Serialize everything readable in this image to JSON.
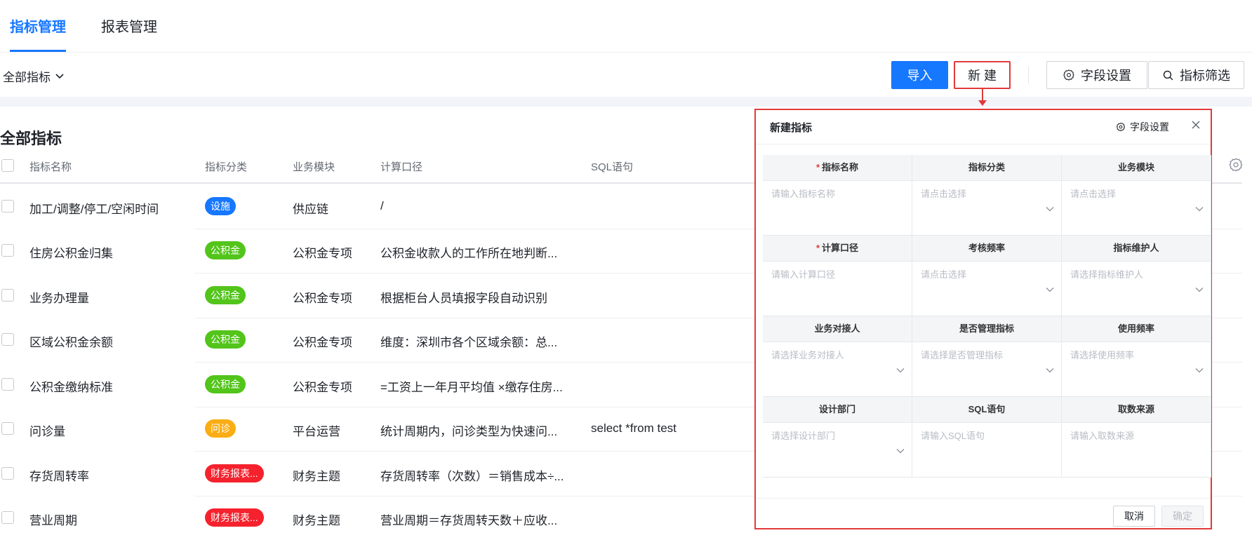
{
  "tabs": [
    {
      "label": "指标管理",
      "active": true
    },
    {
      "label": "报表管理",
      "active": false
    }
  ],
  "toolbar": {
    "filter": "全部指标",
    "import": "导入",
    "new": "新 建",
    "field_settings": "字段设置",
    "filter_btn": "指标筛选"
  },
  "table": {
    "title": "全部指标",
    "headers": [
      "指标名称",
      "指标分类",
      "业务模块",
      "计算口径",
      "SQL语句"
    ],
    "rows": [
      {
        "name": "加工/调整/停工/空闲时间",
        "tag": "设施",
        "tag_color": "#1677ff",
        "module": "供应链",
        "calc": "/",
        "sql": ""
      },
      {
        "name": "住房公积金归集",
        "tag": "公积金",
        "tag_color": "#52c41a",
        "module": "公积金专项",
        "calc": "公积金收款人的工作所在地判断...",
        "sql": ""
      },
      {
        "name": "业务办理量",
        "tag": "公积金",
        "tag_color": "#52c41a",
        "module": "公积金专项",
        "calc": "根据柜台人员填报字段自动识别",
        "sql": ""
      },
      {
        "name": "区域公积金余额",
        "tag": "公积金",
        "tag_color": "#52c41a",
        "module": "公积金专项",
        "calc": "维度：深圳市各个区域余额：总...",
        "sql": ""
      },
      {
        "name": "公积金缴纳标准",
        "tag": "公积金",
        "tag_color": "#52c41a",
        "module": "公积金专项",
        "calc": "=工资上一年月平均值 ×缴存住房...",
        "sql": ""
      },
      {
        "name": "问诊量",
        "tag": "问诊",
        "tag_color": "#faad14",
        "module": "平台运营",
        "calc": "统计周期内，问诊类型为快速问...",
        "sql": "select *from test"
      },
      {
        "name": "存货周转率",
        "tag": "财务报表...",
        "tag_color": "#f5222d",
        "module": "财务主题",
        "calc": "存货周转率（次数）＝销售成本÷...",
        "sql": ""
      },
      {
        "name": "营业周期",
        "tag": "财务报表...",
        "tag_color": "#f5222d",
        "module": "财务主题",
        "calc": "营业周期＝存货周转天数＋应收...",
        "sql": ""
      }
    ]
  },
  "panel": {
    "title": "新建指标",
    "field_settings": "字段设置",
    "fields": [
      {
        "label": "指标名称",
        "required": true,
        "placeholder": "请输入指标名称",
        "select": false
      },
      {
        "label": "指标分类",
        "required": false,
        "placeholder": "请点击选择",
        "select": true
      },
      {
        "label": "业务模块",
        "required": false,
        "placeholder": "请点击选择",
        "select": true
      },
      {
        "label": "计算口径",
        "required": true,
        "placeholder": "请输入计算口径",
        "select": false
      },
      {
        "label": "考核频率",
        "required": false,
        "placeholder": "请点击选择",
        "select": true
      },
      {
        "label": "指标维护人",
        "required": false,
        "placeholder": "请选择指标维护人",
        "select": true
      },
      {
        "label": "业务对接人",
        "required": false,
        "placeholder": "请选择业务对接人",
        "select": true
      },
      {
        "label": "是否管理指标",
        "required": false,
        "placeholder": "请选择是否管理指标",
        "select": true
      },
      {
        "label": "使用频率",
        "required": false,
        "placeholder": "请选择使用频率",
        "select": true
      },
      {
        "label": "设计部门",
        "required": false,
        "placeholder": "请选择设计部门",
        "select": true
      },
      {
        "label": "SQL语句",
        "required": false,
        "placeholder": "请输入SQL语句",
        "select": false
      },
      {
        "label": "取数来源",
        "required": false,
        "placeholder": "请输入取数来源",
        "select": false
      }
    ],
    "cancel": "取消",
    "confirm": "确定"
  },
  "icons": {
    "chevron": "chevron-down-icon",
    "gear": "gear-icon",
    "search": "search-icon",
    "close": "close-icon"
  },
  "colors": {
    "primary": "#1677ff",
    "highlight": "#e03a3a"
  }
}
